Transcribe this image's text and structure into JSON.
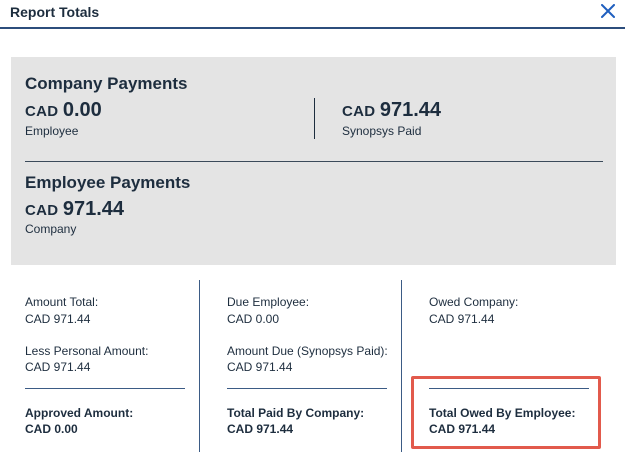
{
  "dialog": {
    "title": "Report Totals",
    "close_icon": "close-icon"
  },
  "company_payments": {
    "title": "Company Payments",
    "employee": {
      "currency": "CAD",
      "amount": "0.00",
      "label": "Employee"
    },
    "synopsys_paid": {
      "currency": "CAD",
      "amount": "971.44",
      "label": "Synopsys Paid"
    }
  },
  "employee_payments": {
    "title": "Employee Payments",
    "company": {
      "currency": "CAD",
      "amount": "971.44",
      "label": "Company"
    }
  },
  "totals": {
    "col1": {
      "amount_total": {
        "label": "Amount Total:",
        "value": "CAD 971.44"
      },
      "less_personal": {
        "label": "Less Personal Amount:",
        "value": "CAD 971.44"
      },
      "approved": {
        "label": "Approved Amount:",
        "value": "CAD 0.00"
      }
    },
    "col2": {
      "due_employee": {
        "label": "Due Employee:",
        "value": "CAD 0.00"
      },
      "amount_due": {
        "label": "Amount Due (Synopsys Paid):",
        "value": "CAD 971.44"
      },
      "total_paid_by_company": {
        "label": "Total Paid By Company:",
        "value": "CAD 971.44"
      }
    },
    "col3": {
      "owed_company": {
        "label": "Owed Company:",
        "value": "CAD 971.44"
      },
      "total_owed_by_employee": {
        "label": "Total Owed By Employee:",
        "value": "CAD 971.44"
      }
    }
  },
  "colors": {
    "header_rule": "#2c4d7c",
    "close_icon": "#1f5fbf",
    "panel_bg": "#e4e4e4",
    "highlight_border": "#e25a4c"
  }
}
